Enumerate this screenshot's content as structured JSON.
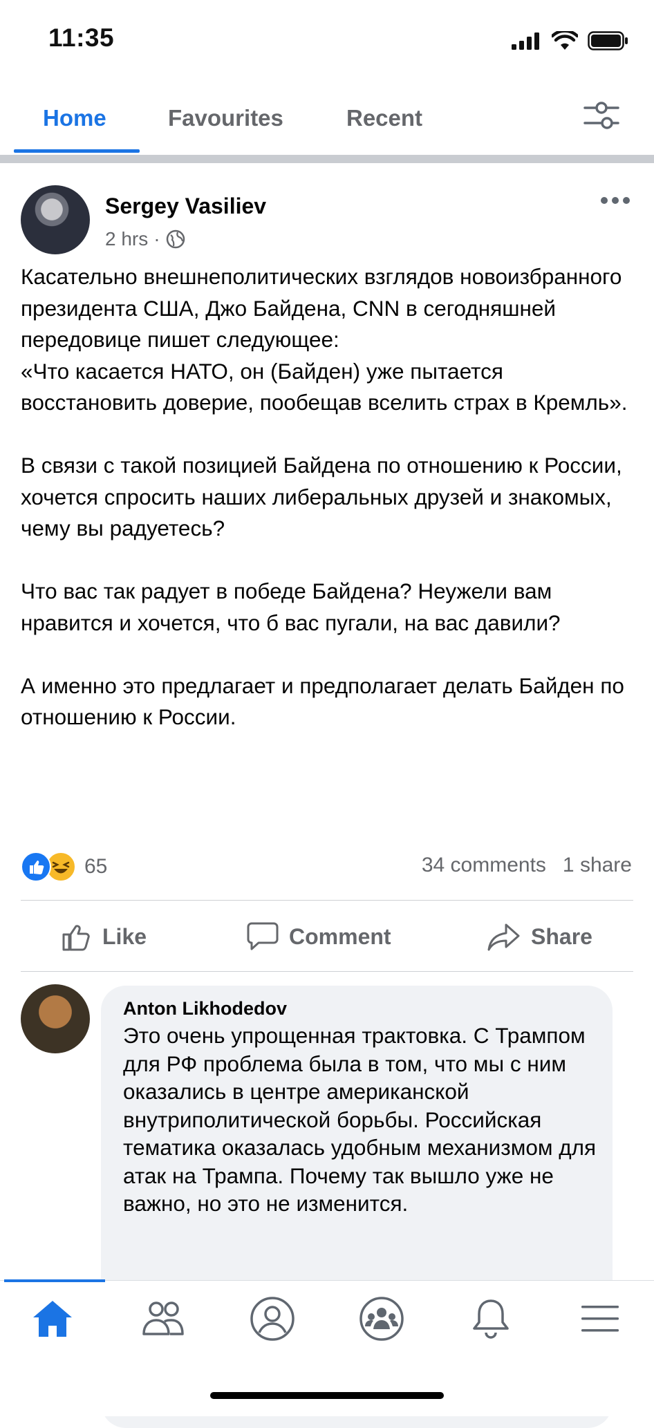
{
  "status_bar": {
    "time": "11:35"
  },
  "tabs": [
    {
      "label": "Home",
      "active": true
    },
    {
      "label": "Favourites",
      "active": false
    },
    {
      "label": "Recent",
      "active": false
    }
  ],
  "post": {
    "author": "Sergey Vasiliev",
    "time": "2 hrs",
    "privacy_icon": "globe-icon",
    "paragraphs": [
      "Касательно внешнеполитических взглядов новоизбранного президента США, Джо Байдена, CNN в сегодняшней передовице пишет следующее:\n«Что касается НАТО, он (Байден) уже пытается восстановить доверие, пообещав вселить страх в Кремль».",
      "В связи с такой позицией Байдена по отношению к России, хочется спросить наших либеральных друзей и знакомых, чему вы радуетесь?",
      "Что вас так радует в победе Байдена? Неужели вам нравится и хочется, что б вас пугали, на вас давили?",
      "А именно это предлагает и предполагает делать Байден по отношению к России."
    ],
    "reactions_count": "65",
    "comments_count": "34 comments",
    "shares_count": "1 share"
  },
  "actions": {
    "like": "Like",
    "comment": "Comment",
    "share": "Share"
  },
  "comment": {
    "author": "Anton Likhodedov",
    "text": "Это очень упрощенная трактовка. С Трампом для РФ проблема была в том, что мы с ним оказались в центре американской внутриполитической борьбы. Российская тематика оказалась удобным механизмом для атак на Трампа. Почему так вышло уже не важно, но это не изменится."
  },
  "colors": {
    "accent": "#1b74e4",
    "text_secondary": "#65676b",
    "bubble": "#f0f2f5"
  },
  "bottom_nav": [
    "home-icon",
    "friends-icon",
    "profile-icon",
    "groups-icon",
    "notifications-icon",
    "menu-icon"
  ]
}
